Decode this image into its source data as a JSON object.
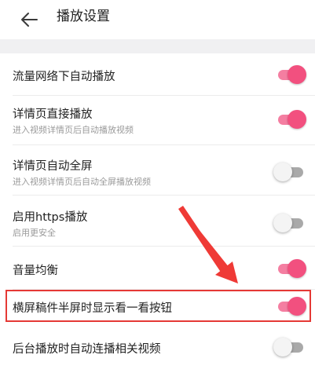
{
  "header": {
    "title": "播放设置",
    "back_icon": "arrow-left-icon"
  },
  "colors": {
    "accent": "#f2507f",
    "accent_track": "#f47ea1",
    "highlight": "#e53935",
    "section_gap": "#f0f0f2"
  },
  "settings": [
    {
      "title": "流量网络下自动播放",
      "subtitle": "",
      "toggle": "on"
    },
    {
      "title": "详情页直接播放",
      "subtitle": "进入视频详情页后自动播放视频",
      "toggle": "on"
    },
    {
      "title": "详情页自动全屏",
      "subtitle": "进入视频详情页后自动全屏播放视频",
      "toggle": "off"
    },
    {
      "title": "启用https播放",
      "subtitle": "启用更安全",
      "toggle": "off"
    },
    {
      "title": "音量均衡",
      "subtitle": "",
      "toggle": "on"
    },
    {
      "title": "横屏稿件半屏时显示看一看按钮",
      "subtitle": "",
      "toggle": "on",
      "highlighted": true
    },
    {
      "title": "后台播放时自动连播相关视频",
      "subtitle": "",
      "toggle": "off"
    }
  ]
}
